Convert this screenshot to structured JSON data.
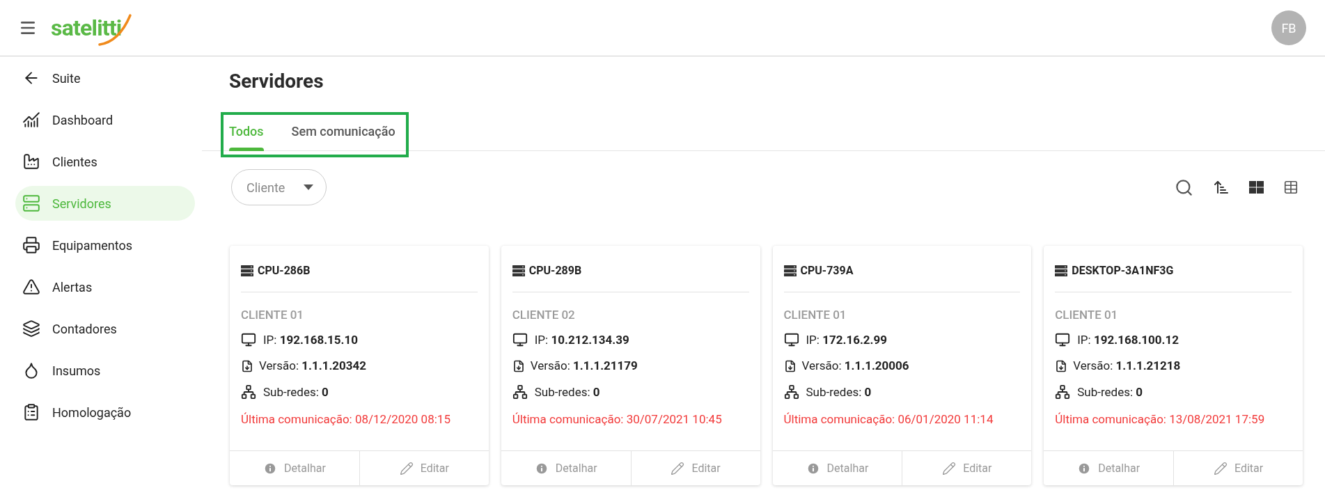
{
  "header": {
    "logo": "satelitti",
    "avatar": "FB"
  },
  "sidebar": {
    "items": [
      {
        "label": "Suite",
        "selected": false
      },
      {
        "label": "Dashboard",
        "selected": false
      },
      {
        "label": "Clientes",
        "selected": false
      },
      {
        "label": "Servidores",
        "selected": true
      },
      {
        "label": "Equipamentos",
        "selected": false
      },
      {
        "label": "Alertas",
        "selected": false
      },
      {
        "label": "Contadores",
        "selected": false
      },
      {
        "label": "Insumos",
        "selected": false
      },
      {
        "label": "Homologação",
        "selected": false
      }
    ]
  },
  "page": {
    "title": "Servidores"
  },
  "tabs": [
    {
      "label": "Todos",
      "selected": true
    },
    {
      "label": "Sem comunicação",
      "selected": false
    }
  ],
  "filter": {
    "label": "Cliente"
  },
  "cards": [
    {
      "name": "CPU-286B",
      "client": "CLIENTE 01",
      "ip_label": "IP:",
      "ip": "192.168.15.10",
      "version_label": "Versão:",
      "version": "1.1.1.20342",
      "subnets_label": "Sub-redes:",
      "subnets": "0",
      "last_comm": "Última comunicação: 08/12/2020 08:15",
      "actions": [
        "Detalhar",
        "Editar"
      ]
    },
    {
      "name": "CPU-289B",
      "client": "CLIENTE 02",
      "ip_label": "IP:",
      "ip": "10.212.134.39",
      "version_label": "Versão:",
      "version": "1.1.1.21179",
      "subnets_label": "Sub-redes:",
      "subnets": "0",
      "last_comm": "Última comunicação: 30/07/2021 10:45",
      "actions": [
        "Detalhar",
        "Editar"
      ]
    },
    {
      "name": "CPU-739A",
      "client": "CLIENTE 01",
      "ip_label": "IP:",
      "ip": "172.16.2.99",
      "version_label": "Versão:",
      "version": "1.1.1.20006",
      "subnets_label": "Sub-redes:",
      "subnets": "0",
      "last_comm": "Última comunicação: 06/01/2020 11:14",
      "actions": [
        "Detalhar",
        "Editar"
      ]
    },
    {
      "name": "DESKTOP-3A1NF3G",
      "client": "CLIENTE 01",
      "ip_label": "IP:",
      "ip": "192.168.100.12",
      "version_label": "Versão:",
      "version": "1.1.1.21218",
      "subnets_label": "Sub-redes:",
      "subnets": "0",
      "last_comm": "Última comunicação: 13/08/2021 17:59",
      "actions": [
        "Detalhar",
        "Editar"
      ]
    }
  ]
}
